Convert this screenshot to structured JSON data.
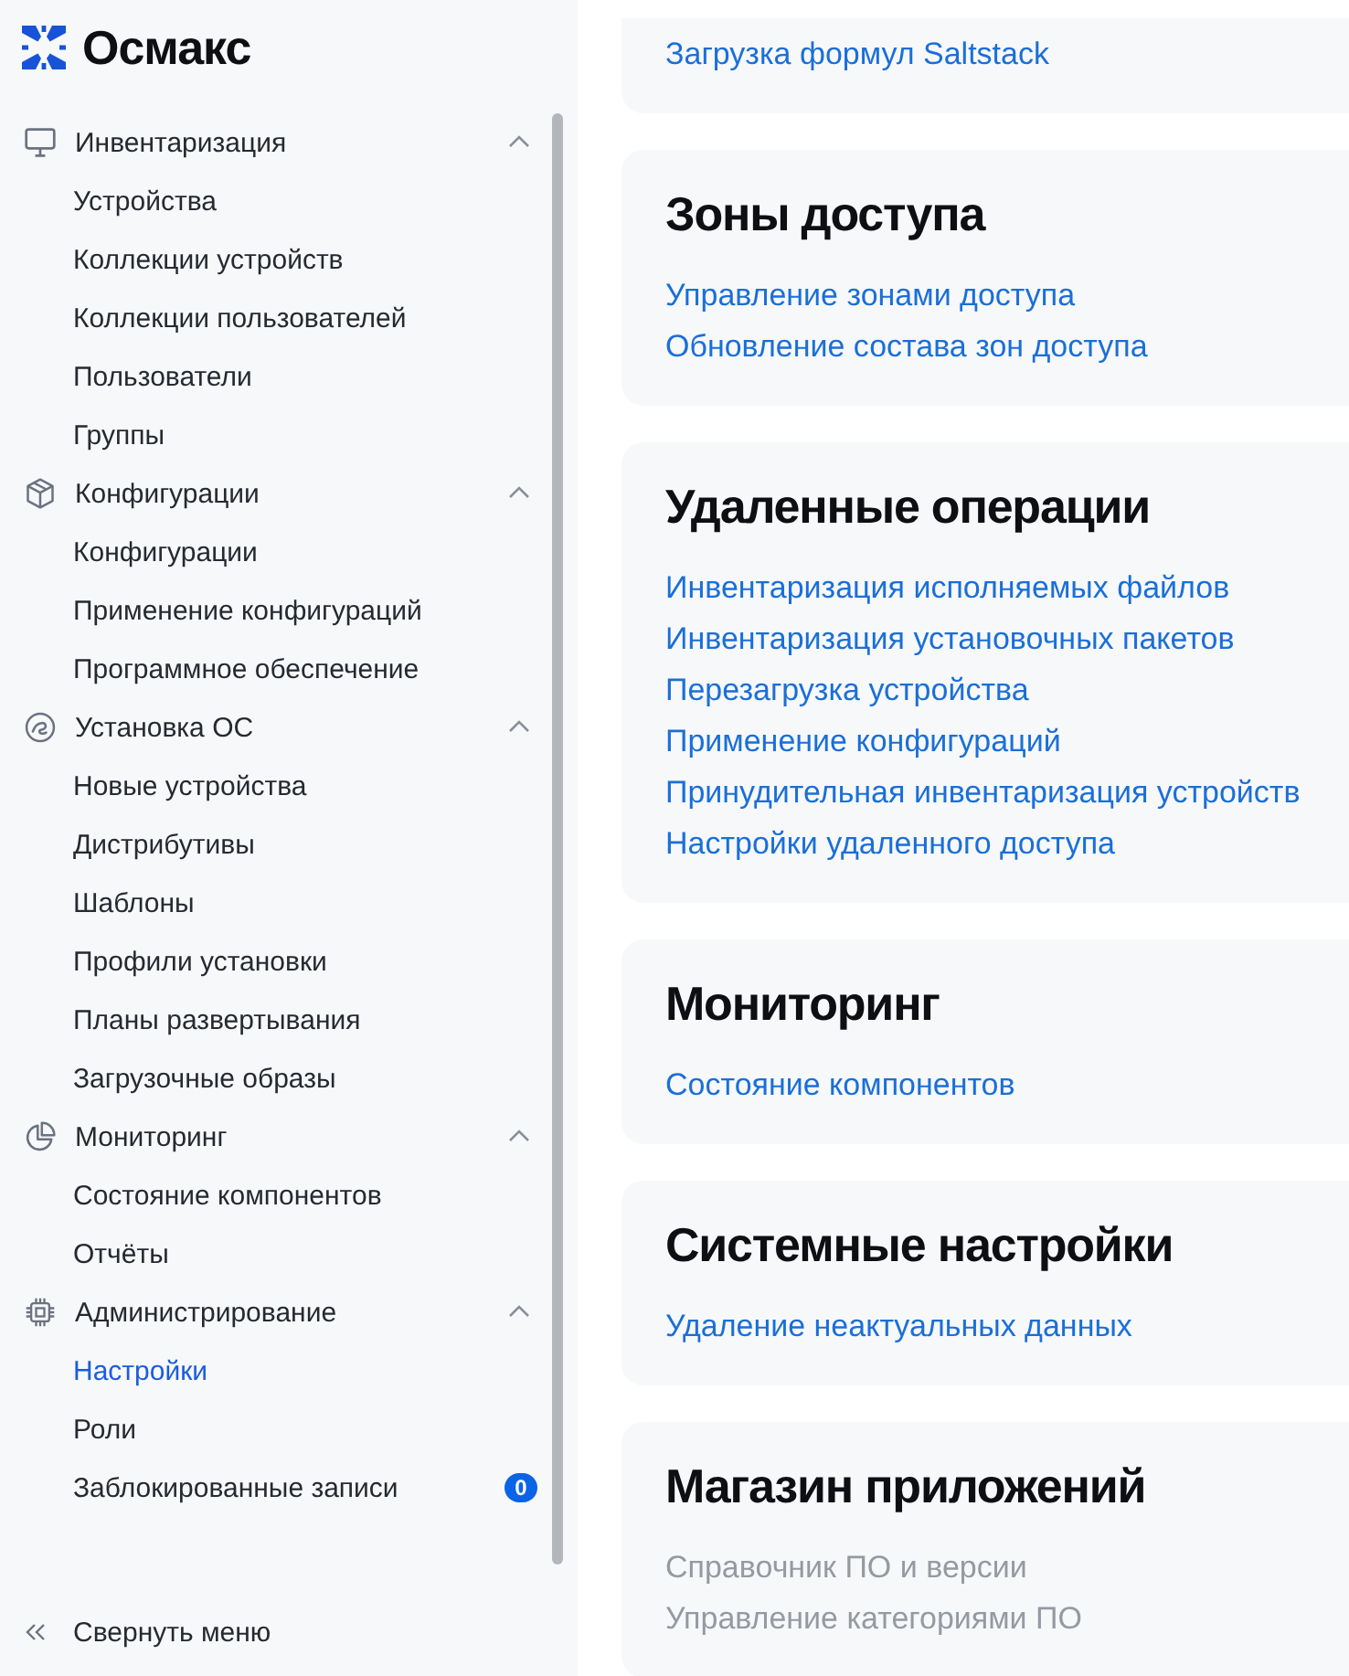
{
  "sidebar": {
    "logo": {
      "text": "Осмакс"
    },
    "groups": [
      {
        "label": "Инвентаризация",
        "expanded": true,
        "children": [
          {
            "label": "Устройства",
            "selected": false
          },
          {
            "label": "Коллекции устройств",
            "selected": false
          },
          {
            "label": "Коллекции пользователей",
            "selected": false
          },
          {
            "label": "Пользователи",
            "selected": false
          },
          {
            "label": "Группы",
            "selected": false
          }
        ]
      },
      {
        "label": "Конфигурации",
        "expanded": true,
        "children": [
          {
            "label": "Конфигурации",
            "selected": false
          },
          {
            "label": "Применение конфигураций",
            "selected": false
          },
          {
            "label": "Программное обеспечение",
            "selected": false
          }
        ]
      },
      {
        "label": "Установка ОС",
        "expanded": true,
        "children": [
          {
            "label": "Новые устройства",
            "selected": false
          },
          {
            "label": "Дистрибутивы",
            "selected": false
          },
          {
            "label": "Шаблоны",
            "selected": false
          },
          {
            "label": "Профили установки",
            "selected": false
          },
          {
            "label": "Планы развертывания",
            "selected": false
          },
          {
            "label": "Загрузочные образы",
            "selected": false
          }
        ]
      },
      {
        "label": "Мониторинг",
        "expanded": true,
        "children": [
          {
            "label": "Состояние компонентов",
            "selected": false
          },
          {
            "label": "Отчёты",
            "selected": false
          }
        ]
      },
      {
        "label": "Администрирование",
        "expanded": true,
        "children": [
          {
            "label": "Настройки",
            "selected": true
          },
          {
            "label": "Роли",
            "selected": false
          },
          {
            "label": "Заблокированные записи",
            "selected": false,
            "badge": "0"
          }
        ]
      }
    ],
    "collapse_button": {
      "label": "Свернуть меню"
    }
  },
  "sections": [
    {
      "links": [
        {
          "label": "Загрузка формул Saltstack",
          "disabled": false
        }
      ]
    },
    {
      "title": "Зоны доступа",
      "links": [
        {
          "label": "Управление зонами доступа",
          "disabled": false
        },
        {
          "label": "Обновление состава зон доступа",
          "disabled": false
        }
      ]
    },
    {
      "title": "Удаленные операции",
      "links": [
        {
          "label": "Инвентаризация исполняемых файлов",
          "disabled": false
        },
        {
          "label": "Инвентаризация установочных пакетов",
          "disabled": false
        },
        {
          "label": "Перезагрузка устройства",
          "disabled": false
        },
        {
          "label": "Применение конфигураций",
          "disabled": false
        },
        {
          "label": "Принудительная инвентаризация устройств",
          "disabled": false
        },
        {
          "label": "Настройки удаленного доступа",
          "disabled": false
        }
      ]
    },
    {
      "title": "Мониторинг",
      "links": [
        {
          "label": "Состояние компонентов",
          "disabled": false
        }
      ]
    },
    {
      "title": "Системные настройки",
      "links": [
        {
          "label": "Удаление неактуальных данных",
          "disabled": false
        }
      ]
    },
    {
      "title": "Магазин приложений",
      "links": [
        {
          "label": "Справочник ПО и версии",
          "disabled": true
        },
        {
          "label": "Управление категориями ПО",
          "disabled": true
        }
      ]
    }
  ]
}
